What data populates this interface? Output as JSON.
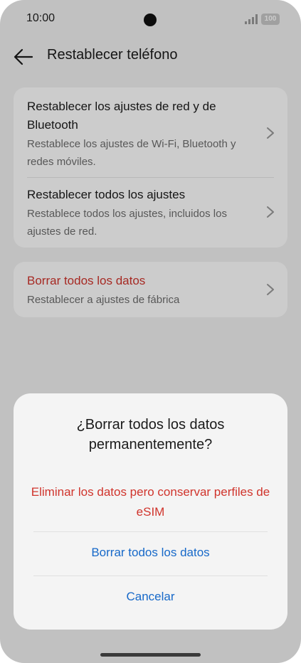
{
  "status_bar": {
    "time": "10:00",
    "battery": "100"
  },
  "header": {
    "title": "Restablecer teléfono"
  },
  "settings": {
    "group1": [
      {
        "title": "Restablecer los ajustes de red y de Bluetooth",
        "subtitle": "Restablece los ajustes de Wi-Fi, Bluetooth y redes móviles."
      },
      {
        "title": "Restablecer todos los ajustes",
        "subtitle": "Restablece todos los ajustes, incluidos los ajustes de red."
      }
    ],
    "group2": [
      {
        "title": "Borrar todos los datos",
        "subtitle": "Restablecer a ajustes de fábrica"
      }
    ]
  },
  "dialog": {
    "title": "¿Borrar todos los datos permanentemente?",
    "option_keep_esim": "Eliminar los datos pero conservar perfiles de eSIM",
    "option_erase_all": "Borrar todos los datos",
    "option_cancel": "Cancelar"
  },
  "colors": {
    "danger": "#d0342c",
    "action": "#1769c9",
    "background": "#f2f2f2"
  }
}
